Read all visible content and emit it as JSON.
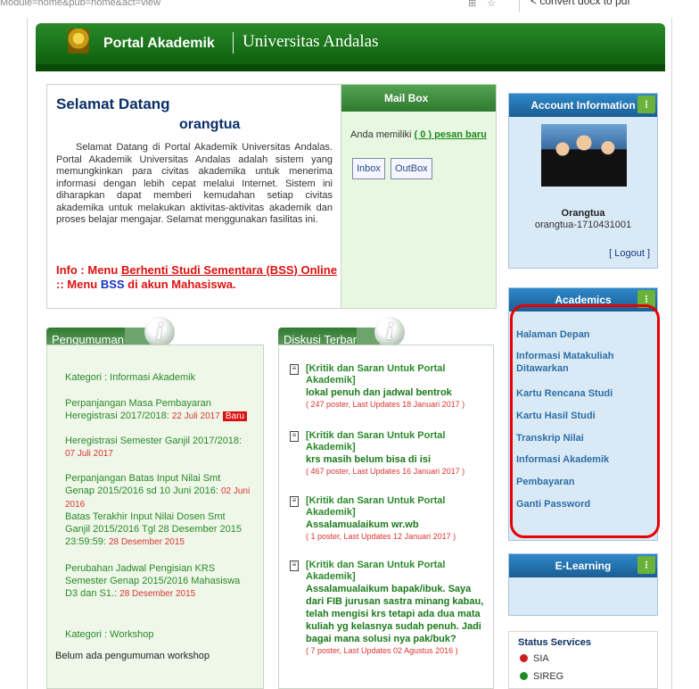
{
  "browser": {
    "url_text": "Module=home&pub=home&act=view",
    "search_text": "convert docx to pdf",
    "toolbar_icons": [
      "bookmark-icon",
      "star-icon"
    ]
  },
  "header": {
    "portal_title": "Portal Akademik",
    "university": "Universitas Andalas"
  },
  "welcome": {
    "heading": "Selamat Datang",
    "username": "orangtua",
    "paragraph": "Selamat Datang di Portal Akademik Universitas Andalas. Portal Akademik Universitas Andalas adalah sistem yang memungkinkan para civitas akademika untuk menerima informasi dengan lebih cepat melalui Internet. Sistem ini diharapkan dapat memberi kemudahan setiap civitas akademika untuk melakukan aktivitas-aktivitas akademik dan proses belajar mengajar. Selamat menggunakan fasilitas ini.",
    "info_prefix": "Info : Menu ",
    "info_link": "Berhenti Studi Sementara (BSS) Online",
    "info_middle": " :: Menu ",
    "info_bss": "BSS",
    "info_suffix": " di akun Mahasiswa."
  },
  "mailbox": {
    "title": "Mail Box",
    "text_prefix": "Anda memiliki ",
    "link": "( 0 ) pesan baru",
    "inbox_label": "Inbox",
    "outbox_label": "OutBox"
  },
  "announcements": {
    "title": "Pengumuman",
    "category1": "Kategori : Informasi Akademik",
    "items": [
      {
        "text": "Perpanjangan Masa Pembayaran Heregistrasi 2017/2018:",
        "date": "22 Juli 2017",
        "badge": "Baru"
      },
      {
        "text": "Heregistrasi Semester Ganjil 2017/2018:",
        "date": "07 Juli 2017"
      },
      {
        "text": "Perpanjangan Batas Input Nilai Smt Genap 2015/2016 sd 10 Juni 2016:",
        "date": "02 Juni 2016"
      },
      {
        "text": "Batas Terakhir Input Nilai Dosen Smt Ganjil 2015/2016 Tgl 28 Desember 2015 23:59:59:",
        "date": "28 Desember 2015"
      },
      {
        "text": "Perubahan Jadwal Pengisian KRS Semester Genap 2015/2016 Mahasiswa D3 dan S1.:",
        "date": "28 Desember 2015"
      }
    ],
    "category2": "Kategori : Workshop",
    "none_text": "Belum ada pengumuman workshop"
  },
  "discussions": {
    "title": "Diskusi Terbaru",
    "posts": [
      {
        "forum": "[Kritik dan Saran Untuk Portal Akademik]",
        "topic": "lokal penuh dan jadwal bentrok",
        "meta": "( 247 poster, Last Updates 18 Januari 2017 )"
      },
      {
        "forum": "[Kritik dan Saran Untuk Portal Akademik]",
        "topic": "krs masih belum bisa di isi",
        "meta": "( 467 poster, Last Updates 16 Januari 2017 )"
      },
      {
        "forum": "[Kritik dan Saran Untuk Portal Akademik]",
        "topic": "Assalamualaikum wr.wb",
        "meta": "( 1 poster, Last Updates 12 Januari 2017 )"
      },
      {
        "forum": "[Kritik dan Saran Untuk Portal Akademik]",
        "topic": "Assalamualaikum bapak/ibuk. Saya dari FIB jurusan sastra minang kabau, telah mengisi krs tetapi ada dua mata kuliah yg kelasnya sudah penuh. Jadi bagai mana solusi nya pak/buk?",
        "meta": "( 7 poster, Last Updates 02 Agustus 2016 )"
      }
    ]
  },
  "account": {
    "title": "Account Information",
    "name": "Orangtua",
    "user_id": "orangtua-1710431001",
    "logout": "[ Logout ]"
  },
  "academics": {
    "title": "Academics",
    "menu": [
      "Halaman Depan",
      "Informasi Matakuliah Ditawarkan",
      "Kartu Rencana Studi",
      "Kartu Hasil Studi",
      "Transkrip Nilai",
      "Informasi Akademik",
      "Pembayaran",
      "Ganti Password"
    ]
  },
  "elearning": {
    "title": "E-Learning"
  },
  "status": {
    "title": "Status Services",
    "services": [
      {
        "name": "SIA",
        "color": "#c81e1e"
      },
      {
        "name": "SIREG",
        "color": "#1c8a2a"
      }
    ]
  },
  "colors": {
    "header_green": "#176f17",
    "side_blue": "#1b5e94",
    "highlight_ring": "#e60000"
  }
}
